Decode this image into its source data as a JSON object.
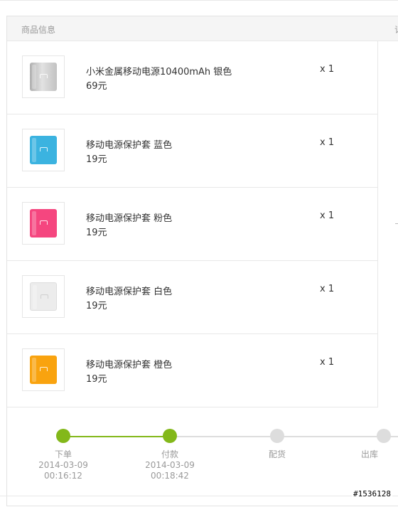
{
  "header": {
    "col_product": "商品信息",
    "col_right_partial": "订"
  },
  "items": [
    {
      "name": "小米金属移动电源10400mAh 银色",
      "price": "69元",
      "qty": "x 1",
      "color": "#c8c8c8",
      "icon": "silver-power-bank-icon"
    },
    {
      "name": "移动电源保护套 蓝色",
      "price": "19元",
      "qty": "x 1",
      "color": "#3bb3e0",
      "icon": "blue-power-bank-case-icon"
    },
    {
      "name": "移动电源保护套 粉色",
      "price": "19元",
      "qty": "x 1",
      "color": "#f5467f",
      "icon": "pink-power-bank-case-icon"
    },
    {
      "name": "移动电源保护套 白色",
      "price": "19元",
      "qty": "x 1",
      "color": "#ebebeb",
      "icon": "white-power-bank-case-icon"
    },
    {
      "name": "移动电源保护套 橙色",
      "price": "19元",
      "qty": "x 1",
      "color": "#f9a30f",
      "icon": "orange-power-bank-case-icon"
    }
  ],
  "progress": {
    "steps": [
      {
        "label": "下单",
        "date": "2014-03-09",
        "time": "00:16:12",
        "done": true
      },
      {
        "label": "付款",
        "date": "2014-03-09",
        "time": "00:18:42",
        "done": true
      },
      {
        "label": "配货",
        "date": "",
        "time": "",
        "done": false
      },
      {
        "label": "出库",
        "date": "",
        "time": "",
        "done": false
      }
    ],
    "active_color": "#83b81a",
    "inactive_color": "#dddddd"
  },
  "watermark": "#1536128"
}
